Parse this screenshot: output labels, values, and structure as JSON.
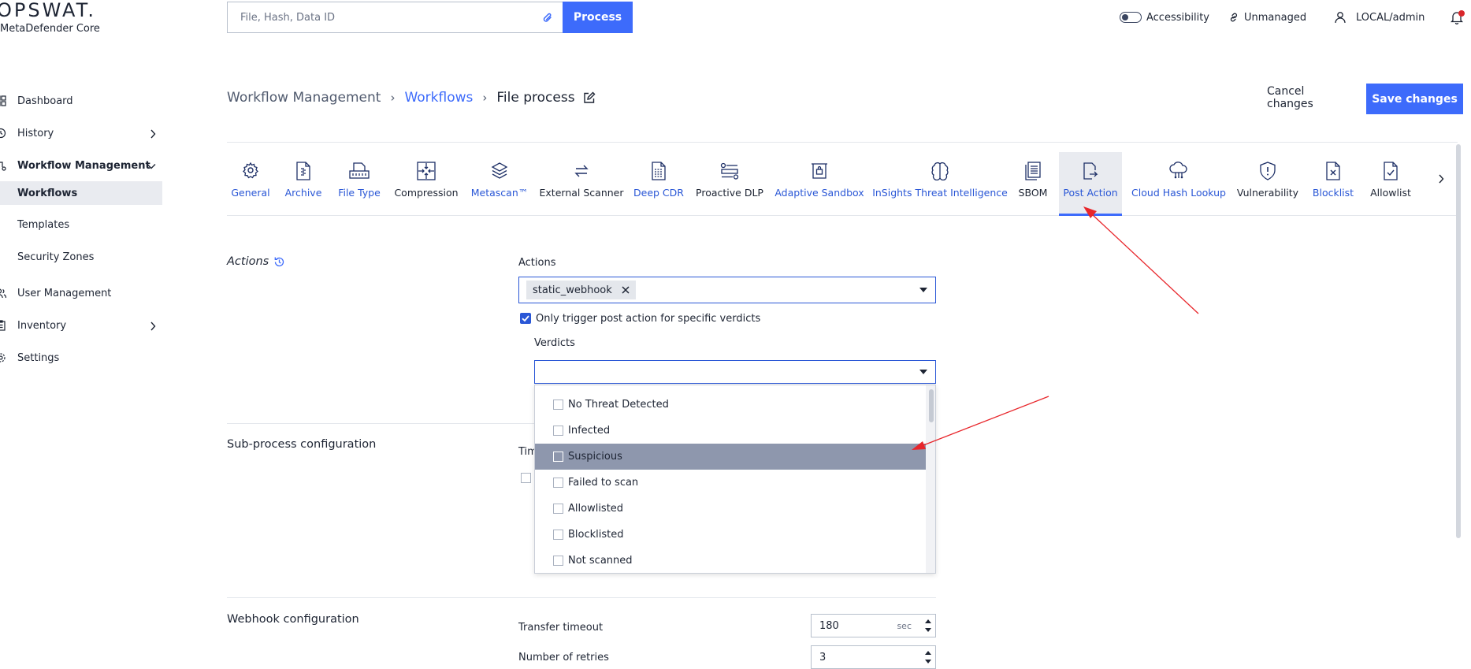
{
  "brand": {
    "logo": "OPSWAT.",
    "product": "MetaDefender Core"
  },
  "search": {
    "placeholder": "File, Hash, Data ID",
    "attach_icon": "paperclip-icon",
    "process_label": "Process"
  },
  "header_right": {
    "accessibility": "Accessibility",
    "unmanaged": "Unmanaged",
    "user": "LOCAL/admin",
    "notification_dot_color": "#d9262b"
  },
  "sidebar": {
    "items": [
      {
        "label": "Dashboard",
        "icon": "grid-icon"
      },
      {
        "label": "History",
        "icon": "clock-icon"
      },
      {
        "label": "Workflow Management",
        "icon": "workflow-icon"
      },
      {
        "label": "Workflows"
      },
      {
        "label": "Templates"
      },
      {
        "label": "Security Zones"
      },
      {
        "label": "User Management",
        "icon": "users-icon"
      },
      {
        "label": "Inventory",
        "icon": "clipboard-icon"
      },
      {
        "label": "Settings",
        "icon": "gear-icon"
      }
    ]
  },
  "breadcrumb": {
    "root": "Workflow Management",
    "parent": "Workflows",
    "current": "File process"
  },
  "buttons": {
    "cancel": "Cancel changes",
    "save": "Save changes"
  },
  "tabs": [
    {
      "label": "General",
      "icon": "gear-icon"
    },
    {
      "label": "Archive",
      "icon": "archive-file-icon"
    },
    {
      "label": "File Type",
      "icon": "file-type-icon"
    },
    {
      "label": "Compression",
      "icon": "compression-icon"
    },
    {
      "label": "Metascan™",
      "icon": "layers-icon"
    },
    {
      "label": "External Scanner",
      "icon": "swap-arrows-icon"
    },
    {
      "label": "Deep CDR",
      "icon": "deep-cdr-icon"
    },
    {
      "label": "Proactive DLP",
      "icon": "dlp-icon"
    },
    {
      "label": "Adaptive Sandbox",
      "icon": "sandbox-icon"
    },
    {
      "label": "InSights Threat Intelligence",
      "icon": "brain-icon"
    },
    {
      "label": "SBOM",
      "icon": "sbom-icon"
    },
    {
      "label": "Post Action",
      "icon": "post-action-icon"
    },
    {
      "label": "Cloud Hash Lookup",
      "icon": "cloud-icon"
    },
    {
      "label": "Vulnerability",
      "icon": "shield-icon"
    },
    {
      "label": "Blocklist",
      "icon": "blocklist-icon"
    },
    {
      "label": "Allowlist",
      "icon": "allowlist-icon"
    }
  ],
  "sections": {
    "actions": {
      "title": "Actions",
      "field_label": "Actions",
      "selected_chip": "static_webhook",
      "trigger_checkbox_label": "Only trigger post action for specific verdicts",
      "verdicts_label": "Verdicts",
      "verdict_options": [
        "No Threat Detected",
        "Infected",
        "Suspicious",
        "Failed to scan",
        "Allowlisted",
        "Blocklisted",
        "Not scanned"
      ]
    },
    "subprocess": {
      "title": "Sub-process configuration",
      "partial_label": "Tim"
    },
    "webhook": {
      "title": "Webhook configuration",
      "transfer_label": "Transfer timeout",
      "transfer_value": "180",
      "transfer_unit": "sec",
      "retries_label": "Number of retries",
      "retries_value": "3"
    }
  },
  "colors": {
    "accent": "#3d6bfb",
    "link": "#2a57d6",
    "highlight": "#8e97ad",
    "annotation": "#e8262b"
  }
}
